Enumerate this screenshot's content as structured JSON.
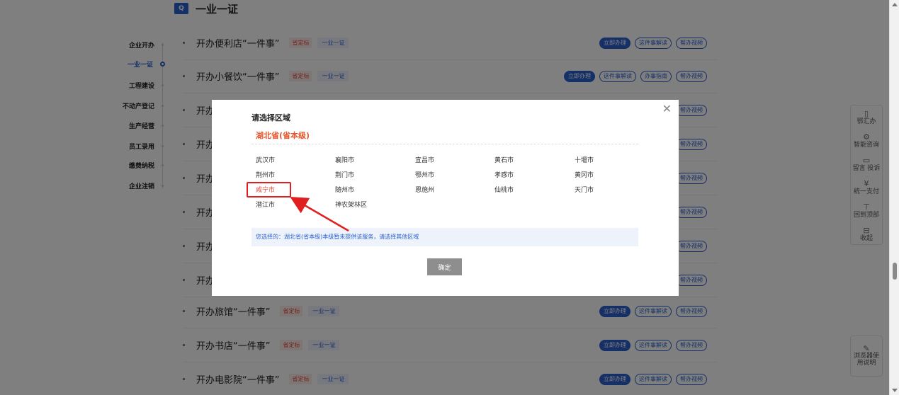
{
  "section": {
    "icon": "flag-icon",
    "title": "一业一证"
  },
  "leftnav": {
    "items": [
      {
        "label": "企业开办",
        "active": false
      },
      {
        "label": "一业一证",
        "active": true
      },
      {
        "label": "工程建设",
        "active": false
      },
      {
        "label": "不动产登记",
        "active": false
      },
      {
        "label": "生产经营",
        "active": false
      },
      {
        "label": "员工录用",
        "active": false
      },
      {
        "label": "缴费纳税",
        "active": false
      },
      {
        "label": "企业注销",
        "active": false
      }
    ]
  },
  "rows": [
    {
      "title": "开办便利店“一件事”",
      "tag_red": "省定标",
      "tag_blue": "一业一证",
      "buttons": [
        "立即办理",
        "这件事解读",
        "帮办视频"
      ]
    },
    {
      "title": "开办小餐饮“一件事”",
      "tag_red": "省定标",
      "tag_blue": "一业一证",
      "buttons": [
        "立即办理",
        "这件事解读",
        "办事指南",
        "帮办视频"
      ]
    },
    {
      "title": "开办",
      "buttons": [
        "帮办视频"
      ]
    },
    {
      "title": "开办",
      "buttons": [
        "帮办视频"
      ]
    },
    {
      "title": "开办",
      "buttons": [
        "帮办视频"
      ]
    },
    {
      "title": "开办",
      "buttons": [
        "帮办视频"
      ]
    },
    {
      "title": "开办",
      "buttons": [
        "帮办视频"
      ]
    },
    {
      "title": "开办",
      "buttons": [
        "帮办视频"
      ]
    },
    {
      "title": "开办旅馆“一件事”",
      "tag_red": "省定标",
      "tag_blue": "一业一证",
      "buttons": [
        "立即办理",
        "这件事解读",
        "帮办视频"
      ]
    },
    {
      "title": "开办书店“一件事”",
      "tag_red": "省定标",
      "tag_blue": "一业一证",
      "buttons": [
        "立即办理",
        "这件事解读",
        "帮办视频"
      ]
    },
    {
      "title": "开办电影院“一件事”",
      "tag_red": "省定标",
      "tag_blue": "一业一证",
      "buttons": [
        "立即办理",
        "这件事解读",
        "帮办视频"
      ]
    }
  ],
  "floatbar": [
    {
      "icon": "phone-icon",
      "label": "鄂汇办"
    },
    {
      "icon": "robot-icon",
      "label": "智能咨询"
    },
    {
      "icon": "message-icon",
      "label": "留言 投诉"
    },
    {
      "icon": "yen-icon",
      "label": "统一支付"
    },
    {
      "icon": "arrow-up-icon",
      "label": "回到顶部"
    },
    {
      "icon": "collapse-icon",
      "label": "收起"
    }
  ],
  "browser_help": {
    "icon": "edit-icon",
    "label": "浏览器使用说明"
  },
  "modal": {
    "title": "请选择区域",
    "province": "湖北省(省本级)",
    "cities": [
      "武汉市",
      "襄阳市",
      "宜昌市",
      "黄石市",
      "十堰市",
      "荆州市",
      "荆门市",
      "鄂州市",
      "孝感市",
      "黄冈市",
      "咸宁市",
      "随州市",
      "恩施州",
      "仙桃市",
      "天门市",
      "潜江市",
      "神农架林区"
    ],
    "selected_city": "咸宁市",
    "notice": "您选择的：湖北省(省本级)本级暂未提供该服务，请选择其他区域",
    "confirm_label": "确定",
    "close_icon": "close-icon"
  },
  "colors": {
    "accent": "#2a5fcf",
    "province": "#e8542c",
    "highlight_box": "#e02020"
  }
}
